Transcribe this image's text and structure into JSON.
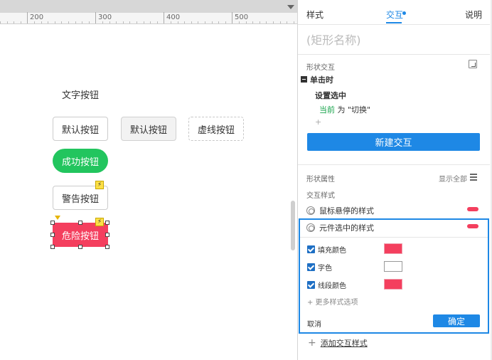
{
  "canvas": {
    "ruler": {
      "labels": [
        "200",
        "300",
        "400",
        "500"
      ]
    },
    "buttons": {
      "text_button": "文字按钮",
      "default_1": "默认按钮",
      "default_2": "默认按钮",
      "dashed": "虚线按钮",
      "success": "成功按钮",
      "warning": "警告按钮",
      "danger": "危险按钮"
    },
    "bolt_glyph": "⚡"
  },
  "panel": {
    "tabs": {
      "style": "样式",
      "interaction": "交互",
      "notes": "说明"
    },
    "shape_name_placeholder": "(矩形名称)",
    "shape_interaction_label": "形状交互",
    "event": {
      "label": "单击时"
    },
    "action": {
      "label": "设置选中",
      "current": "当前",
      "rest": " 为 \"切换\""
    },
    "add_small": "+",
    "new_interaction_label": "新建交互",
    "shape_props_label": "形状属性",
    "show_all_label": "显示全部",
    "interaction_style_label": "交互样式",
    "hover_style_label": "鼠标悬停的样式",
    "selected_style_label": "元件选中的样式",
    "props": {
      "fill": "填充颜色",
      "font": "字色",
      "line": "线段颜色"
    },
    "more_options": "+ 更多样式选项",
    "cancel_label": "取消",
    "confirm_label": "确定",
    "add_style": {
      "plus": "+",
      "label": "添加交互样式"
    }
  },
  "colors": {
    "accent": "#1e88e5",
    "danger": "#f43f5e",
    "success": "#22c55e",
    "current_green": "#16a34a"
  }
}
